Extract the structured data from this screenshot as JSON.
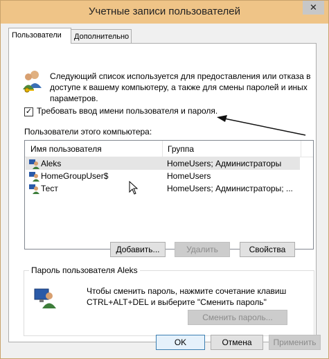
{
  "window": {
    "title": "Учетные записи пользователей",
    "close_label": "✕"
  },
  "tabs": [
    {
      "label": "Пользователи",
      "active": true
    },
    {
      "label": "Дополнительно",
      "active": false
    }
  ],
  "description": "Следующий список используется для предоставления или отказа в доступе к вашему компьютеру, а также для смены паролей и иных параметров.",
  "require_login": {
    "label": "Требовать ввод имени пользователя и пароля.",
    "checked": true,
    "check_glyph": "✓"
  },
  "users_list": {
    "label": "Пользователи этого компьютера:",
    "columns": [
      "Имя пользователя",
      "Группа"
    ],
    "rows": [
      {
        "name": "Aleks",
        "group": "HomeUsers; Администраторы",
        "selected": true
      },
      {
        "name": "HomeGroupUser$",
        "group": "HomeUsers",
        "selected": false
      },
      {
        "name": "Тест",
        "group": "HomeUsers; Администраторы; ...",
        "selected": false
      }
    ]
  },
  "buttons": {
    "add": "Добавить...",
    "remove": "Удалить",
    "properties": "Свойства"
  },
  "password_group": {
    "title": "Пароль пользователя Aleks",
    "line1": "Чтобы сменить пароль, нажмите сочетание клавиш",
    "line2": "CTRL+ALT+DEL и выберите \"Сменить пароль\"",
    "button": "Сменить пароль..."
  },
  "footer": {
    "ok": "OK",
    "cancel": "Отмена",
    "apply": "Применить"
  },
  "colors": {
    "titlebar": "#efc487",
    "selection": "#e5e5e5"
  },
  "icons": {
    "users": "users-key-icon",
    "user": "user-icon",
    "computer": "computer-user-icon",
    "arrow": "annotation-arrow",
    "cursor": "mouse-cursor-icon"
  }
}
